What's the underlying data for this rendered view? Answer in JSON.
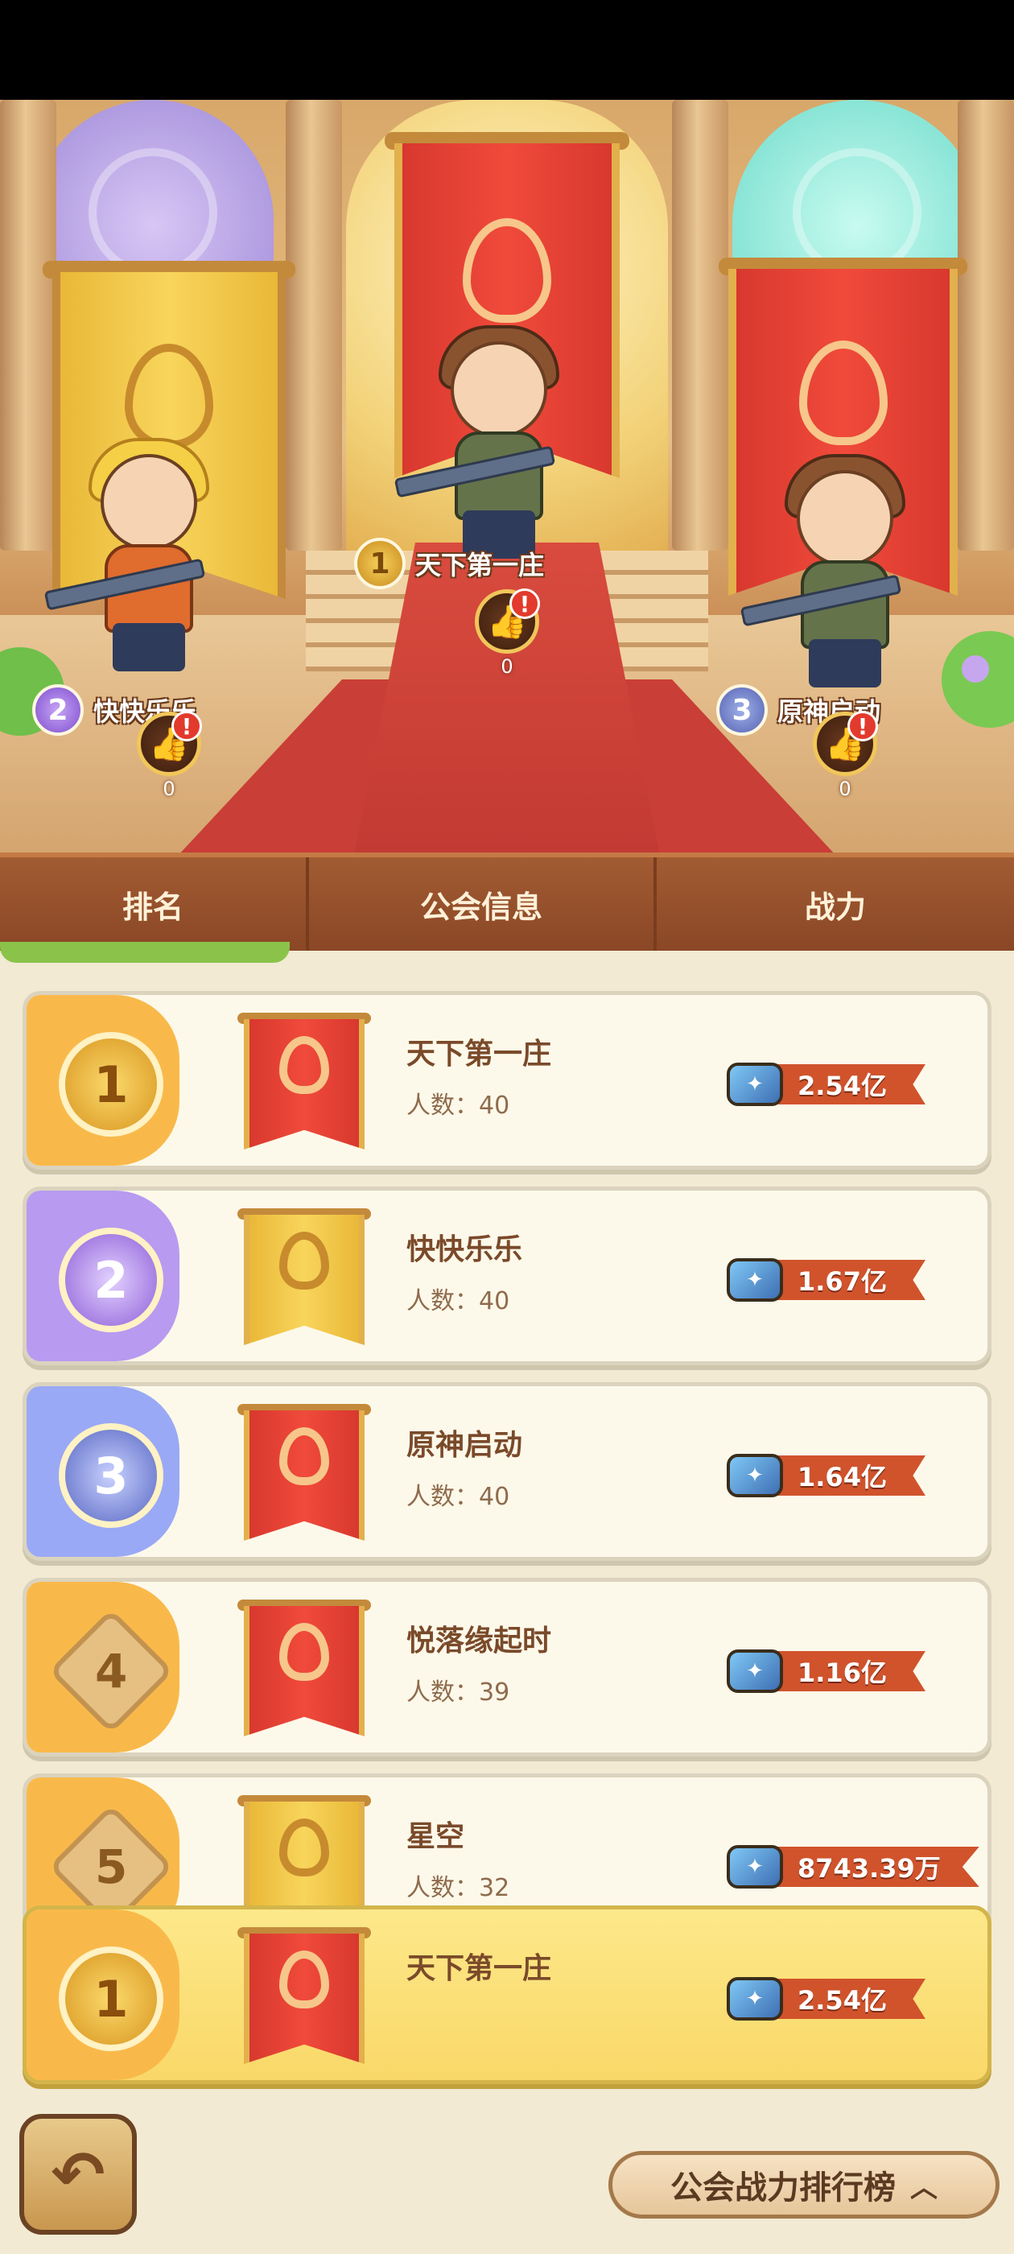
{
  "podium": [
    {
      "rank": "1",
      "name": "天下第一庄",
      "likes": "0"
    },
    {
      "rank": "2",
      "name": "快快乐乐",
      "likes": "0"
    },
    {
      "rank": "3",
      "name": "原神启动",
      "likes": "0"
    }
  ],
  "header": {
    "rank": "排名",
    "guild_info": "公会信息",
    "power": "战力"
  },
  "member_label": "人数：",
  "guilds": [
    {
      "rank": "1",
      "name": "天下第一庄",
      "members": "40",
      "power": "2.54亿",
      "banner": "red"
    },
    {
      "rank": "2",
      "name": "快快乐乐",
      "members": "40",
      "power": "1.67亿",
      "banner": "gold"
    },
    {
      "rank": "3",
      "name": "原神启动",
      "members": "40",
      "power": "1.64亿",
      "banner": "red"
    },
    {
      "rank": "4",
      "name": "悦落缘起时",
      "members": "39",
      "power": "1.16亿",
      "banner": "red"
    },
    {
      "rank": "5",
      "name": "星空",
      "members": "32",
      "power": "8743.39万",
      "banner": "gold"
    }
  ],
  "my_guild": {
    "rank": "1",
    "name": "天下第一庄",
    "power": "2.54亿"
  },
  "footer": {
    "board_label": "公会战力排行榜",
    "back_icon": "back-arrow-icon",
    "chevron_icon": "chevron-up-icon"
  },
  "colors": {
    "accent": "#d0532c",
    "mine_bg": "#fde88a",
    "tab_bg": "#a25c33"
  }
}
